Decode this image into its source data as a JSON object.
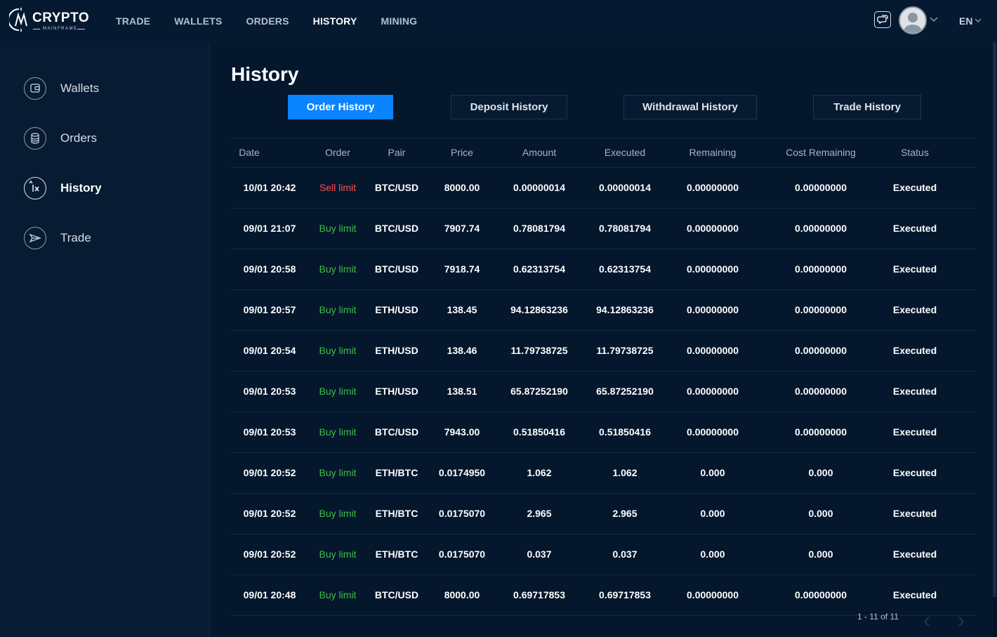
{
  "brand": {
    "word": "CRYPTO",
    "sub": "MAINFRAME"
  },
  "nav": [
    {
      "label": "TRADE",
      "active": false
    },
    {
      "label": "WALLETS",
      "active": false
    },
    {
      "label": "ORDERS",
      "active": false
    },
    {
      "label": "HISTORY",
      "active": true
    },
    {
      "label": "MINING",
      "active": false
    }
  ],
  "header": {
    "language": "EN"
  },
  "sidebar": {
    "items": [
      {
        "label": "Wallets",
        "icon": "wallet-icon",
        "active": false
      },
      {
        "label": "Orders",
        "icon": "coins-icon",
        "active": false
      },
      {
        "label": "History",
        "icon": "history-icon",
        "active": true
      },
      {
        "label": "Trade",
        "icon": "send-icon",
        "active": false
      }
    ]
  },
  "page": {
    "title": "History"
  },
  "tabs": [
    {
      "label": "Order History",
      "active": true
    },
    {
      "label": "Deposit History",
      "active": false
    },
    {
      "label": "Withdrawal History",
      "active": false
    },
    {
      "label": "Trade History",
      "active": false
    }
  ],
  "table": {
    "columns": [
      "Date",
      "Order",
      "Pair",
      "Price",
      "Amount",
      "Executed",
      "Remaining",
      "Cost Remaining",
      "Status"
    ],
    "rows": [
      {
        "date": "10/01 20:42",
        "order": "Sell limit",
        "side": "sell",
        "pair": "BTC/USD",
        "price": "8000.00",
        "amount": "0.00000014",
        "executed": "0.00000014",
        "remaining": "0.00000000",
        "cost_remaining": "0.00000000",
        "status": "Executed"
      },
      {
        "date": "09/01 21:07",
        "order": "Buy limit",
        "side": "buy",
        "pair": "BTC/USD",
        "price": "7907.74",
        "amount": "0.78081794",
        "executed": "0.78081794",
        "remaining": "0.00000000",
        "cost_remaining": "0.00000000",
        "status": "Executed"
      },
      {
        "date": "09/01 20:58",
        "order": "Buy limit",
        "side": "buy",
        "pair": "BTC/USD",
        "price": "7918.74",
        "amount": "0.62313754",
        "executed": "0.62313754",
        "remaining": "0.00000000",
        "cost_remaining": "0.00000000",
        "status": "Executed"
      },
      {
        "date": "09/01 20:57",
        "order": "Buy limit",
        "side": "buy",
        "pair": "ETH/USD",
        "price": "138.45",
        "amount": "94.12863236",
        "executed": "94.12863236",
        "remaining": "0.00000000",
        "cost_remaining": "0.00000000",
        "status": "Executed"
      },
      {
        "date": "09/01 20:54",
        "order": "Buy limit",
        "side": "buy",
        "pair": "ETH/USD",
        "price": "138.46",
        "amount": "11.79738725",
        "executed": "11.79738725",
        "remaining": "0.00000000",
        "cost_remaining": "0.00000000",
        "status": "Executed"
      },
      {
        "date": "09/01 20:53",
        "order": "Buy limit",
        "side": "buy",
        "pair": "ETH/USD",
        "price": "138.51",
        "amount": "65.87252190",
        "executed": "65.87252190",
        "remaining": "0.00000000",
        "cost_remaining": "0.00000000",
        "status": "Executed"
      },
      {
        "date": "09/01 20:53",
        "order": "Buy limit",
        "side": "buy",
        "pair": "BTC/USD",
        "price": "7943.00",
        "amount": "0.51850416",
        "executed": "0.51850416",
        "remaining": "0.00000000",
        "cost_remaining": "0.00000000",
        "status": "Executed"
      },
      {
        "date": "09/01 20:52",
        "order": "Buy limit",
        "side": "buy",
        "pair": "ETH/BTC",
        "price": "0.0174950",
        "amount": "1.062",
        "executed": "1.062",
        "remaining": "0.000",
        "cost_remaining": "0.000",
        "status": "Executed"
      },
      {
        "date": "09/01 20:52",
        "order": "Buy limit",
        "side": "buy",
        "pair": "ETH/BTC",
        "price": "0.0175070",
        "amount": "2.965",
        "executed": "2.965",
        "remaining": "0.000",
        "cost_remaining": "0.000",
        "status": "Executed"
      },
      {
        "date": "09/01 20:52",
        "order": "Buy limit",
        "side": "buy",
        "pair": "ETH/BTC",
        "price": "0.0175070",
        "amount": "0.037",
        "executed": "0.037",
        "remaining": "0.000",
        "cost_remaining": "0.000",
        "status": "Executed"
      },
      {
        "date": "09/01 20:48",
        "order": "Buy limit",
        "side": "buy",
        "pair": "BTC/USD",
        "price": "8000.00",
        "amount": "0.69717853",
        "executed": "0.69717853",
        "remaining": "0.00000000",
        "cost_remaining": "0.00000000",
        "status": "Executed"
      }
    ]
  },
  "pagination": {
    "summary": "1 - 11 of 11"
  },
  "colors": {
    "accent": "#0a84ff",
    "sell": "#ff4d4f",
    "buy": "#3fbd45",
    "background": "#04172c"
  }
}
